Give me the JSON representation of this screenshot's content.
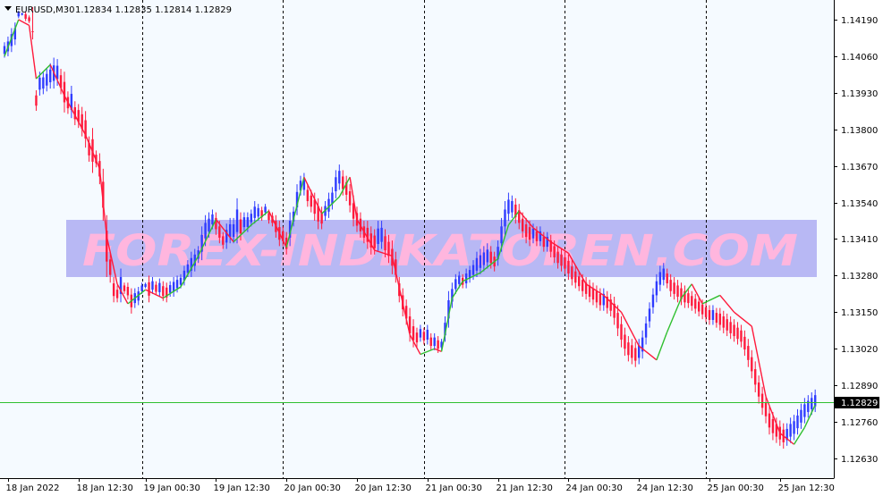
{
  "header": {
    "symbol": "EURUSD,M30",
    "quotes": "1.12834 1.12835 1.12814 1.12829",
    "menu_icon": "triangle-down-icon"
  },
  "watermark": "FOREX-INDIKATOREN.COM",
  "colors": {
    "background": "#f5faff",
    "bull_candle": "#2f3cff",
    "bear_candle": "#ff1a3c",
    "line_up": "#30c030",
    "line_down": "#ff1a3c",
    "grid": "#000000",
    "watermark_band": "#b8b8f4",
    "watermark_text": "#ffb6de",
    "current_price_line": "#30c030"
  },
  "chart_data": {
    "type": "candlestick",
    "symbol": "EURUSD",
    "timeframe": "M30",
    "ylim": [
      1.1256,
      1.1426
    ],
    "y_ticks": [
      "1.14190",
      "1.14060",
      "1.13930",
      "1.13800",
      "1.13670",
      "1.13540",
      "1.13410",
      "1.13280",
      "1.13150",
      "1.13020",
      "1.12890",
      "1.12760",
      "1.12630"
    ],
    "y_tick_values": [
      1.1419,
      1.1406,
      1.1393,
      1.138,
      1.1367,
      1.1354,
      1.1341,
      1.1328,
      1.1315,
      1.1302,
      1.1289,
      1.1276,
      1.1263
    ],
    "x_ticks": [
      "18 Jan 2022",
      "18 Jan 12:30",
      "19 Jan 00:30",
      "19 Jan 12:30",
      "20 Jan 00:30",
      "20 Jan 12:30",
      "21 Jan 00:30",
      "21 Jan 12:30",
      "24 Jan 00:30",
      "24 Jan 12:30",
      "25 Jan 00:30",
      "25 Jan 12:30"
    ],
    "x_tick_index": [
      1,
      21,
      40,
      60,
      80,
      100,
      120,
      140,
      160,
      180,
      200,
      220
    ],
    "day_separator_index": [
      39,
      79,
      119,
      159,
      199
    ],
    "current_price": 1.12829,
    "current_price_label": "1.12829",
    "close_path": [
      [
        0,
        1.1406
      ],
      [
        4,
        1.1419
      ],
      [
        7,
        1.1417
      ],
      [
        9,
        1.1398
      ],
      [
        13,
        1.1403
      ],
      [
        17,
        1.1392
      ],
      [
        23,
        1.1378
      ],
      [
        27,
        1.1366
      ],
      [
        29,
        1.1342
      ],
      [
        32,
        1.1325
      ],
      [
        35,
        1.1318
      ],
      [
        40,
        1.1323
      ],
      [
        45,
        1.132
      ],
      [
        50,
        1.1324
      ],
      [
        55,
        1.1335
      ],
      [
        60,
        1.1348
      ],
      [
        65,
        1.134
      ],
      [
        70,
        1.1346
      ],
      [
        75,
        1.1351
      ],
      [
        80,
        1.1338
      ],
      [
        85,
        1.1363
      ],
      [
        90,
        1.135
      ],
      [
        95,
        1.1356
      ],
      [
        98,
        1.1363
      ],
      [
        100,
        1.1348
      ],
      [
        105,
        1.1337
      ],
      [
        110,
        1.1335
      ],
      [
        115,
        1.1307
      ],
      [
        118,
        1.13
      ],
      [
        122,
        1.1302
      ],
      [
        124,
        1.1301
      ],
      [
        127,
        1.132
      ],
      [
        130,
        1.1326
      ],
      [
        135,
        1.1329
      ],
      [
        140,
        1.1334
      ],
      [
        143,
        1.1346
      ],
      [
        146,
        1.1351
      ],
      [
        150,
        1.1345
      ],
      [
        155,
        1.134
      ],
      [
        160,
        1.1336
      ],
      [
        165,
        1.1325
      ],
      [
        170,
        1.1321
      ],
      [
        175,
        1.1315
      ],
      [
        180,
        1.1303
      ],
      [
        185,
        1.1298
      ],
      [
        188,
        1.1308
      ],
      [
        192,
        1.132
      ],
      [
        195,
        1.1325
      ],
      [
        198,
        1.1318
      ],
      [
        203,
        1.1321
      ],
      [
        207,
        1.1315
      ],
      [
        212,
        1.131
      ],
      [
        216,
        1.1285
      ],
      [
        220,
        1.1272
      ],
      [
        224,
        1.1268
      ],
      [
        227,
        1.1274
      ],
      [
        230,
        1.1282
      ]
    ],
    "anchors": [
      [
        0,
        1.14055,
        1.1411
      ],
      [
        1,
        1.1406,
        1.1413
      ],
      [
        2,
        1.14075,
        1.1416
      ],
      [
        3,
        1.141,
        1.1418
      ],
      [
        4,
        1.14195,
        1.14222
      ],
      [
        5,
        1.14205,
        1.14215
      ],
      [
        6,
        1.14185,
        1.14218
      ],
      [
        7,
        1.14178,
        1.14205
      ],
      [
        8,
        1.14235,
        1.1412
      ],
      [
        9,
        1.13866,
        1.13939
      ],
      [
        10,
        1.1392,
        1.14005
      ],
      [
        11,
        1.13925,
        1.14005
      ],
      [
        12,
        1.13935,
        1.14018
      ],
      [
        13,
        1.13945,
        1.14035
      ],
      [
        14,
        1.13945,
        1.14055
      ],
      [
        15,
        1.13955,
        1.1405
      ],
      [
        16,
        1.13925,
        1.14015
      ],
      [
        17,
        1.1386,
        1.14005
      ],
      [
        18,
        1.13855,
        1.13935
      ],
      [
        19,
        1.1384,
        1.13955
      ],
      [
        20,
        1.13815,
        1.139
      ],
      [
        21,
        1.13805,
        1.1389
      ],
      [
        22,
        1.13775,
        1.1388
      ],
      [
        23,
        1.13735,
        1.13865
      ],
      [
        24,
        1.13685,
        1.13775
      ],
      [
        25,
        1.13645,
        1.13805
      ],
      [
        26,
        1.13665,
        1.13725
      ],
      [
        27,
        1.13605,
        1.13715
      ],
      [
        28,
        1.13475,
        1.1366
      ],
      [
        29,
        1.13275,
        1.13495
      ],
      [
        30,
        1.13255,
        1.13365
      ],
      [
        31,
        1.13185,
        1.13275
      ],
      [
        32,
        1.13185,
        1.13245
      ],
      [
        33,
        1.13185,
        1.13305
      ],
      [
        34,
        1.13215,
        1.13255
      ],
      [
        35,
        1.13195,
        1.13255
      ],
      [
        36,
        1.13145,
        1.13235
      ],
      [
        37,
        1.13165,
        1.13235
      ],
      [
        38,
        1.13175,
        1.1324
      ],
      [
        39,
        1.13215,
        1.13255
      ],
      [
        40,
        1.13235,
        1.13255
      ],
      [
        41,
        1.13185,
        1.1328
      ],
      [
        42,
        1.13215,
        1.13275
      ],
      [
        43,
        1.1321,
        1.1326
      ],
      [
        44,
        1.13205,
        1.1327
      ],
      [
        45,
        1.1319,
        1.1326
      ],
      [
        46,
        1.13185,
        1.13255
      ],
      [
        47,
        1.13205,
        1.1326
      ],
      [
        48,
        1.13205,
        1.13275
      ],
      [
        49,
        1.1322,
        1.1328
      ],
      [
        50,
        1.13235,
        1.13285
      ],
      [
        51,
        1.13245,
        1.13315
      ],
      [
        52,
        1.13275,
        1.13335
      ],
      [
        53,
        1.13275,
        1.13365
      ],
      [
        54,
        1.13295,
        1.13375
      ],
      [
        55,
        1.13325,
        1.13385
      ],
      [
        56,
        1.13335,
        1.13455
      ],
      [
        57,
        1.13385,
        1.13495
      ],
      [
        58,
        1.13415,
        1.13505
      ],
      [
        59,
        1.13445,
        1.13515
      ],
      [
        60,
        1.13425,
        1.13505
      ],
      [
        61,
        1.13395,
        1.13475
      ],
      [
        62,
        1.13375,
        1.13435
      ],
      [
        63,
        1.13375,
        1.13465
      ],
      [
        64,
        1.13395,
        1.13485
      ],
      [
        65,
        1.13395,
        1.13485
      ],
      [
        66,
        1.13395,
        1.13555
      ],
      [
        67,
        1.13405,
        1.13505
      ],
      [
        68,
        1.13435,
        1.13505
      ],
      [
        69,
        1.13435,
        1.13505
      ],
      [
        70,
        1.13455,
        1.13515
      ],
      [
        71,
        1.13465,
        1.13545
      ],
      [
        72,
        1.13475,
        1.13535
      ],
      [
        73,
        1.13475,
        1.13525
      ],
      [
        74,
        1.13495,
        1.13535
      ],
      [
        75,
        1.13465,
        1.13515
      ],
      [
        76,
        1.13455,
        1.13505
      ],
      [
        77,
        1.13415,
        1.13495
      ],
      [
        78,
        1.13385,
        1.13475
      ],
      [
        79,
        1.13385,
        1.13455
      ],
      [
        80,
        1.13355,
        1.13435
      ],
      [
        81,
        1.13385,
        1.13505
      ],
      [
        82,
        1.13455,
        1.13525
      ],
      [
        83,
        1.13495,
        1.13605
      ],
      [
        84,
        1.13565,
        1.13635
      ],
      [
        85,
        1.13565,
        1.13645
      ],
      [
        86,
        1.13525,
        1.13605
      ],
      [
        87,
        1.13505,
        1.13585
      ],
      [
        88,
        1.13475,
        1.13575
      ],
      [
        89,
        1.13445,
        1.13555
      ],
      [
        90,
        1.13445,
        1.13525
      ],
      [
        91,
        1.13475,
        1.13545
      ],
      [
        92,
        1.13485,
        1.13575
      ],
      [
        93,
        1.13515,
        1.13595
      ],
      [
        94,
        1.13555,
        1.13655
      ],
      [
        95,
        1.13585,
        1.13675
      ],
      [
        96,
        1.13565,
        1.13655
      ],
      [
        97,
        1.13545,
        1.13635
      ],
      [
        98,
        1.13505,
        1.13605
      ],
      [
        99,
        1.13455,
        1.13565
      ],
      [
        100,
        1.13435,
        1.13525
      ],
      [
        101,
        1.13415,
        1.13505
      ],
      [
        102,
        1.13395,
        1.13475
      ],
      [
        103,
        1.13375,
        1.13475
      ],
      [
        104,
        1.13355,
        1.13455
      ],
      [
        105,
        1.13355,
        1.13445
      ],
      [
        106,
        1.13365,
        1.13475
      ],
      [
        107,
        1.13375,
        1.13475
      ],
      [
        108,
        1.13345,
        1.13445
      ],
      [
        109,
        1.13325,
        1.13425
      ],
      [
        110,
        1.13285,
        1.13405
      ],
      [
        111,
        1.13255,
        1.13365
      ],
      [
        112,
        1.13185,
        1.13275
      ],
      [
        113,
        1.13135,
        1.13235
      ],
      [
        114,
        1.13105,
        1.13195
      ],
      [
        115,
        1.13045,
        1.13165
      ],
      [
        116,
        1.13025,
        1.13125
      ],
      [
        117,
        1.13025,
        1.13095
      ],
      [
        118,
        1.13045,
        1.13105
      ],
      [
        119,
        1.13035,
        1.13095
      ],
      [
        120,
        1.13035,
        1.13105
      ],
      [
        121,
        1.13015,
        1.13075
      ],
      [
        122,
        1.13015,
        1.13075
      ],
      [
        123,
        1.13005,
        1.13065
      ],
      [
        124,
        1.13015,
        1.13055
      ],
      [
        125,
        1.13045,
        1.13135
      ],
      [
        126,
        1.13095,
        1.13225
      ],
      [
        127,
        1.13165,
        1.13255
      ],
      [
        128,
        1.13215,
        1.13285
      ],
      [
        129,
        1.13235,
        1.13295
      ],
      [
        130,
        1.13235,
        1.13285
      ],
      [
        131,
        1.13235,
        1.13305
      ],
      [
        132,
        1.13255,
        1.13315
      ],
      [
        133,
        1.13265,
        1.13335
      ],
      [
        134,
        1.13275,
        1.13365
      ],
      [
        135,
        1.13285,
        1.13375
      ],
      [
        136,
        1.13295,
        1.13385
      ],
      [
        137,
        1.13305,
        1.13395
      ],
      [
        138,
        1.13305,
        1.13385
      ],
      [
        139,
        1.13295,
        1.13365
      ],
      [
        140,
        1.13315,
        1.13405
      ],
      [
        141,
        1.13365,
        1.13485
      ],
      [
        142,
        1.13425,
        1.13545
      ],
      [
        143,
        1.13475,
        1.13575
      ],
      [
        144,
        1.13485,
        1.13565
      ],
      [
        145,
        1.13465,
        1.13555
      ],
      [
        146,
        1.13445,
        1.13535
      ],
      [
        147,
        1.13415,
        1.13505
      ],
      [
        148,
        1.13395,
        1.13485
      ],
      [
        149,
        1.13385,
        1.13475
      ],
      [
        150,
        1.13395,
        1.13465
      ],
      [
        151,
        1.13385,
        1.13455
      ],
      [
        152,
        1.13385,
        1.13455
      ],
      [
        153,
        1.13365,
        1.13435
      ],
      [
        154,
        1.13365,
        1.13435
      ],
      [
        155,
        1.13345,
        1.13425
      ],
      [
        156,
        1.13325,
        1.13405
      ],
      [
        157,
        1.13305,
        1.13385
      ],
      [
        158,
        1.13295,
        1.13375
      ],
      [
        159,
        1.13285,
        1.13365
      ],
      [
        160,
        1.13265,
        1.13355
      ],
      [
        161,
        1.13245,
        1.13335
      ],
      [
        162,
        1.13235,
        1.13315
      ],
      [
        163,
        1.13225,
        1.13295
      ],
      [
        164,
        1.13205,
        1.13285
      ],
      [
        165,
        1.13195,
        1.13275
      ],
      [
        166,
        1.13185,
        1.13265
      ],
      [
        167,
        1.13175,
        1.13255
      ],
      [
        168,
        1.13165,
        1.13245
      ],
      [
        169,
        1.13155,
        1.13235
      ],
      [
        170,
        1.13155,
        1.13235
      ],
      [
        171,
        1.13145,
        1.13225
      ],
      [
        172,
        1.13135,
        1.13215
      ],
      [
        173,
        1.13105,
        1.13205
      ],
      [
        174,
        1.13065,
        1.13175
      ],
      [
        175,
        1.13025,
        1.13135
      ],
      [
        176,
        1.12995,
        1.13095
      ],
      [
        177,
        1.12975,
        1.13065
      ],
      [
        178,
        1.12965,
        1.13055
      ],
      [
        179,
        1.12955,
        1.13045
      ],
      [
        180,
        1.12965,
        1.13055
      ],
      [
        181,
        1.12985,
        1.13085
      ],
      [
        182,
        1.13035,
        1.13135
      ],
      [
        183,
        1.13095,
        1.13185
      ],
      [
        184,
        1.13145,
        1.13235
      ],
      [
        185,
        1.13185,
        1.13285
      ],
      [
        186,
        1.13225,
        1.13315
      ],
      [
        187,
        1.13245,
        1.13325
      ],
      [
        188,
        1.13235,
        1.13305
      ],
      [
        189,
        1.13205,
        1.13285
      ],
      [
        190,
        1.13195,
        1.13275
      ],
      [
        191,
        1.13185,
        1.13265
      ],
      [
        192,
        1.13175,
        1.13255
      ],
      [
        193,
        1.13165,
        1.13245
      ],
      [
        194,
        1.13165,
        1.13235
      ],
      [
        195,
        1.13155,
        1.13225
      ],
      [
        196,
        1.13145,
        1.13215
      ],
      [
        197,
        1.13135,
        1.13205
      ],
      [
        198,
        1.13125,
        1.13195
      ],
      [
        199,
        1.13115,
        1.13185
      ],
      [
        200,
        1.13105,
        1.13175
      ],
      [
        201,
        1.13105,
        1.13175
      ],
      [
        202,
        1.13095,
        1.13165
      ],
      [
        203,
        1.13085,
        1.13165
      ],
      [
        204,
        1.13075,
        1.13155
      ],
      [
        205,
        1.13065,
        1.13145
      ],
      [
        206,
        1.13055,
        1.13135
      ],
      [
        207,
        1.13045,
        1.13125
      ],
      [
        208,
        1.13035,
        1.13115
      ],
      [
        209,
        1.13025,
        1.13105
      ],
      [
        210,
        1.12995,
        1.13085
      ],
      [
        211,
        1.12955,
        1.13055
      ],
      [
        212,
        1.12915,
        1.13015
      ],
      [
        213,
        1.12865,
        1.12975
      ],
      [
        214,
        1.12825,
        1.12925
      ],
      [
        215,
        1.12785,
        1.12885
      ],
      [
        216,
        1.12755,
        1.12855
      ],
      [
        217,
        1.12715,
        1.12815
      ],
      [
        218,
        1.12695,
        1.12795
      ],
      [
        219,
        1.12685,
        1.12775
      ],
      [
        220,
        1.12675,
        1.12765
      ],
      [
        221,
        1.12665,
        1.12755
      ],
      [
        222,
        1.12675,
        1.12755
      ],
      [
        223,
        1.12685,
        1.12775
      ],
      [
        224,
        1.12695,
        1.12785
      ],
      [
        225,
        1.12715,
        1.12805
      ],
      [
        226,
        1.12735,
        1.12825
      ],
      [
        227,
        1.12755,
        1.12845
      ],
      [
        228,
        1.12775,
        1.12855
      ],
      [
        229,
        1.12785,
        1.12865
      ],
      [
        230,
        1.12795,
        1.12875
      ]
    ]
  }
}
